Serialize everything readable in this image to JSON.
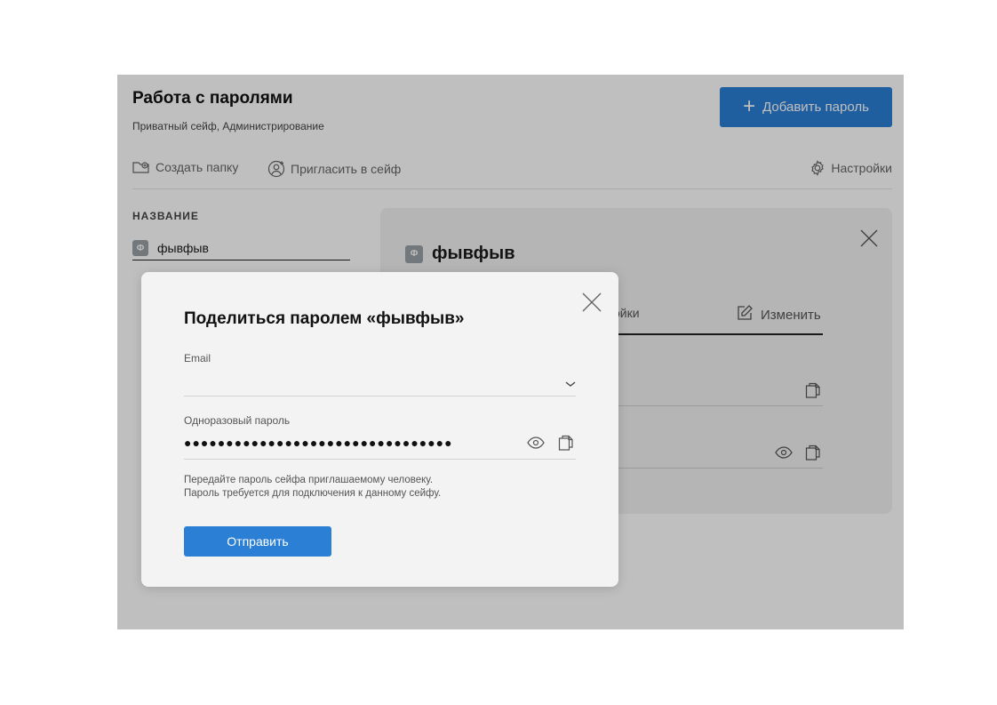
{
  "header": {
    "title": "Работа с паролями",
    "subtitle": "Приватный сейф, Администрирование",
    "add_button_label": "Добавить пароль"
  },
  "toolbar": {
    "create_folder": "Создать папку",
    "invite": "Пригласить в сейф",
    "settings": "Настройки"
  },
  "list": {
    "column_header": "НАЗВАНИЕ",
    "items": [
      {
        "icon_letter": "Ф",
        "name": "фывфыв"
      }
    ]
  },
  "detail": {
    "icon_letter": "Ф",
    "title": "фывфыв",
    "tab_partial": "ойки",
    "edit_label": "Изменить"
  },
  "modal": {
    "title": "Поделиться паролем «фывфыв»",
    "email_label": "Email",
    "email_value": "",
    "otp_label": "Одноразовый пароль",
    "otp_value": "●●●●●●●●●●●●●●●●●●●●●●●●●●●●●●●●",
    "hint_line1": "Передайте пароль сейфа приглашаемому человеку.",
    "hint_line2": "Пароль требуется для подключения к данному сейфу.",
    "send_label": "Отправить"
  },
  "colors": {
    "primary": "#2b7fd4",
    "overlay": "rgba(0,0,0,0.25)"
  },
  "icons": [
    "plus-icon",
    "folder-add-icon",
    "user-add-icon",
    "gear-icon",
    "close-icon",
    "edit-icon",
    "copy-icon",
    "eye-icon",
    "chevron-down-icon"
  ]
}
